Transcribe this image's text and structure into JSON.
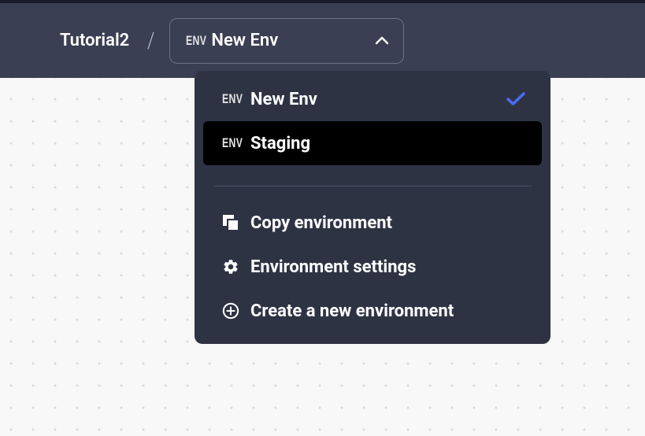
{
  "breadcrumb": {
    "title": "Tutorial2"
  },
  "selector": {
    "tag": "ENV",
    "current": "New Env"
  },
  "dropdown": {
    "items": [
      {
        "tag": "ENV",
        "label": "New Env",
        "selected": true,
        "highlighted": false
      },
      {
        "tag": "ENV",
        "label": "Staging",
        "selected": false,
        "highlighted": true
      }
    ],
    "actions": [
      {
        "icon": "copy",
        "label": "Copy environment"
      },
      {
        "icon": "gear",
        "label": "Environment settings"
      },
      {
        "icon": "plus-circle",
        "label": "Create a new environment"
      }
    ]
  }
}
